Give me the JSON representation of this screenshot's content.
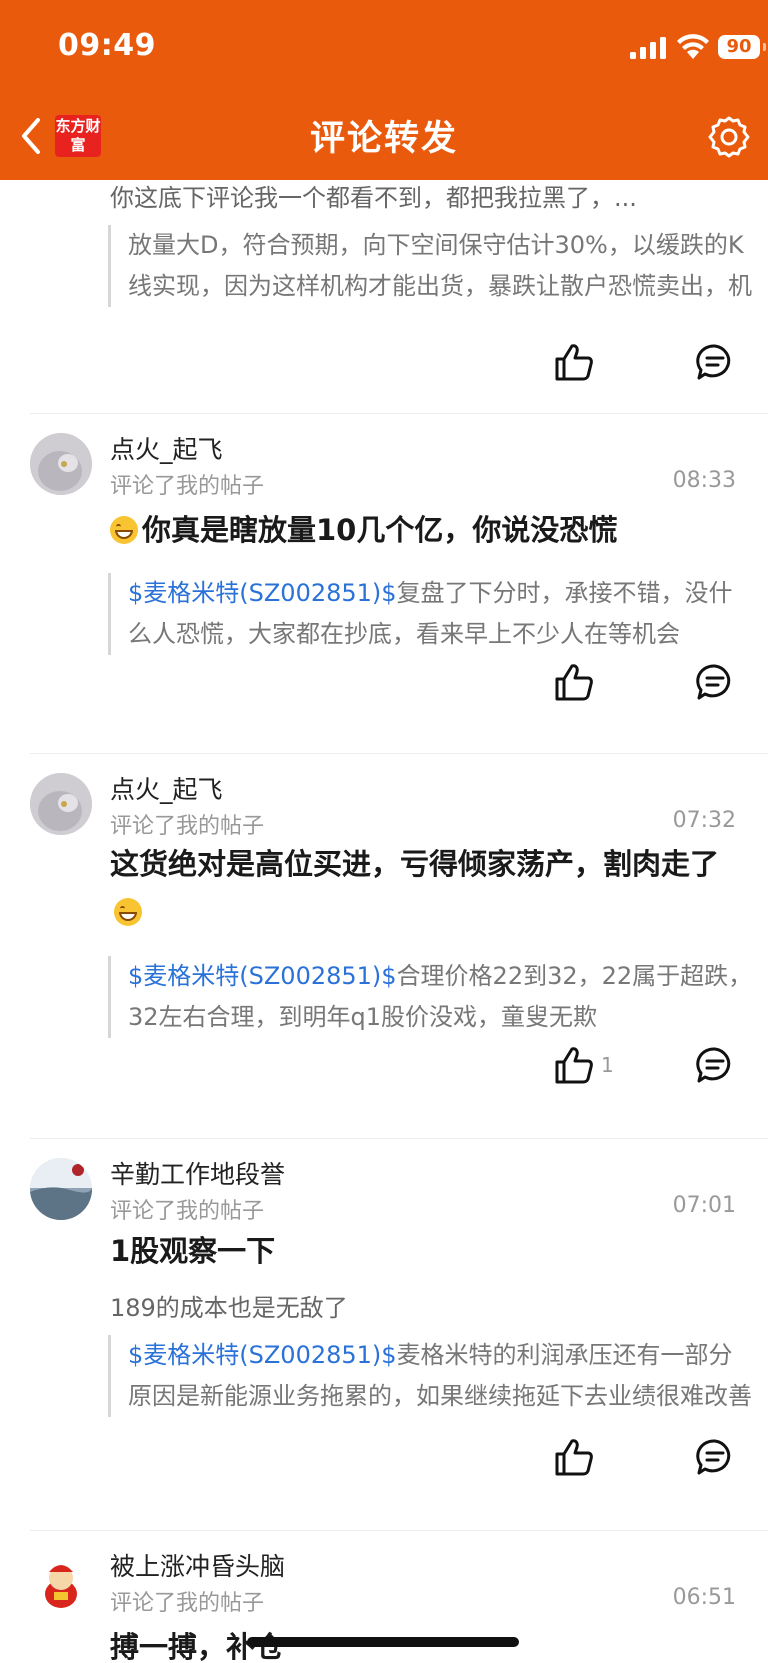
{
  "status_bar": {
    "time": "09:49",
    "battery": "90"
  },
  "header": {
    "title": "评论转发",
    "logo_text": "东方财富"
  },
  "items": [
    {
      "reply": "你这底下评论我一个都看不到，都把我拉黑了，...",
      "quote_text": "放量大D，符合预期，向下空间保守估计30%，以缓跌的K线实现，因为这样机构才能出货，暴跌让散户恐慌卖出，机构接盘"
    },
    {
      "username": "点火_起飞",
      "action": "评论了我的帖子",
      "time": "08:33",
      "main": "你真是瞎放量10几个亿，你说没恐慌",
      "quote_stock": "$麦格米特(SZ002851)$",
      "quote_text": "复盘了下分时，承接不错，没什么人恐慌，大家都在抄底，看来早上不少人在等机会"
    },
    {
      "username": "点火_起飞",
      "action": "评论了我的帖子",
      "time": "07:32",
      "main": "这货绝对是高位买进，亏得倾家荡产，割肉走了",
      "quote_stock": "$麦格米特(SZ002851)$",
      "quote_text": "合理价格22到32，22属于超跌，32左右合理，到明年q1股价没戏，童叟无欺",
      "like_count": "1"
    },
    {
      "username": "辛勤工作地段誉",
      "action": "评论了我的帖子",
      "time": "07:01",
      "main": "1股观察一下",
      "reply": "189的成本也是无敌了",
      "quote_stock": "$麦格米特(SZ002851)$",
      "quote_text": "麦格米特的利润承压还有一部分原因是新能源业务拖累的，如果继续拖延下去业绩很难改善"
    },
    {
      "username": "被上涨冲昏头脑",
      "action": "评论了我的帖子",
      "time": "06:51",
      "main": "搏一搏，补仓"
    }
  ]
}
